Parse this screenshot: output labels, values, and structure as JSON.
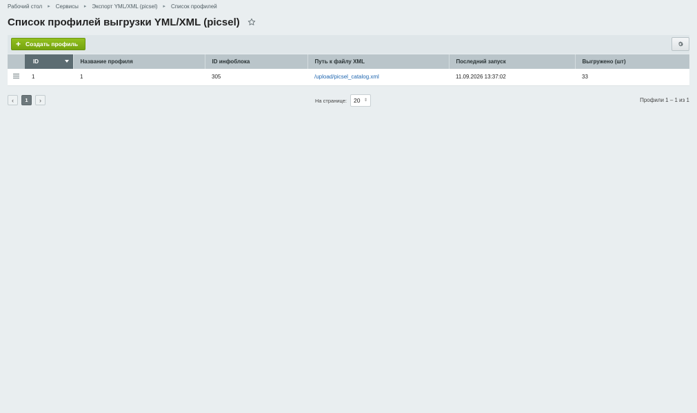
{
  "breadcrumb": {
    "items": [
      "Рабочий стол",
      "Сервисы",
      "Экспорт YML/XML (picsel)",
      "Список профилей"
    ]
  },
  "header": {
    "title": "Список профилей выгрузки YML/XML (picsel)"
  },
  "toolbar": {
    "create_label": "Создать профиль"
  },
  "table": {
    "columns": [
      "ID",
      "Название профиля",
      "ID инфоблока",
      "Путь к файлу XML",
      "Последний запуск",
      "Выгружено (шт)"
    ],
    "rows": [
      {
        "id": "1",
        "name": "1",
        "iblock_id": "305",
        "xml_path": "/upload/picsel_catalog.xml",
        "last_run": "11.09.2026 13:37:02",
        "exported": "33"
      }
    ]
  },
  "pager": {
    "prev": "‹",
    "current": "1",
    "next": "›",
    "per_page_label": "На странице:",
    "per_page_value": "20",
    "total_text": "Профили 1 – 1 из 1"
  },
  "colors": {
    "accent_green": "#7fae14",
    "header_bg": "#bac5ca",
    "sorted_header_bg": "#5c6c72",
    "link": "#2067b0"
  },
  "icons": [
    "star-icon",
    "plus-icon",
    "gear-icon",
    "row-menu-icon",
    "sort-desc-icon"
  ]
}
